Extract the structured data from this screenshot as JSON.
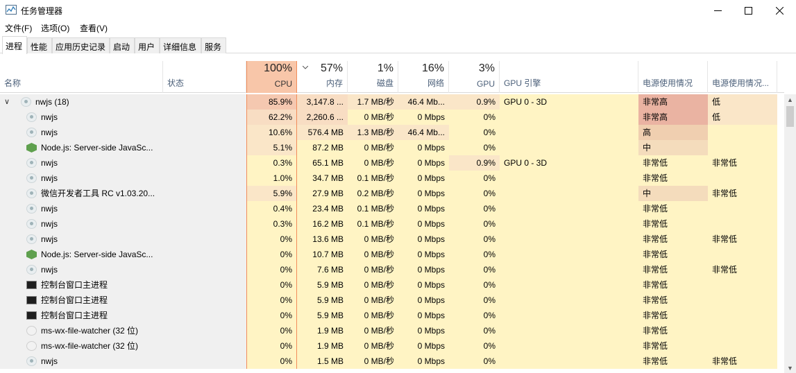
{
  "window": {
    "title": "任务管理器",
    "minimize_glyph": "—",
    "maximize_glyph": "☐",
    "close_glyph": "✕"
  },
  "menu": [
    "文件(F)",
    "选项(O)",
    "查看(V)"
  ],
  "tabs": [
    "进程",
    "性能",
    "应用历史记录",
    "启动",
    "用户",
    "详细信息",
    "服务"
  ],
  "active_tab": "进程",
  "header": {
    "name": "名称",
    "status": "状态",
    "cpu_pct": "100%",
    "cpu": "CPU",
    "mem_pct": "57%",
    "mem": "内存",
    "disk_pct": "1%",
    "disk": "磁盘",
    "net_pct": "16%",
    "net": "网络",
    "gpu_pct": "3%",
    "gpu": "GPU",
    "gpu_engine": "GPU 引擎",
    "power": "电源使用情况",
    "power_trend": "电源使用情况..."
  },
  "colors": {
    "cpu_header_bg": "#f8c6a9",
    "cpu_border": "#f28c5a",
    "heat_very_high": "#f5c8b0",
    "heat_high": "#f8ddc3",
    "heat_mid": "#fae6c8",
    "heat_low": "#fff4c4",
    "heat_lowest": "#fff9dd",
    "power_very_high": "#eab3a2",
    "power_high": "#f0cfb0",
    "power_mid": "#f4dcbc",
    "power_low": "#fff4c4",
    "name_col_bg": "#f0f0f0"
  },
  "processes": [
    {
      "icon": "nwjs-icon",
      "expander": "∨",
      "name": "nwjs (18)",
      "cpu": "85.9%",
      "mem": "3,147.8 ...",
      "disk": "1.7 MB/秒",
      "net": "46.4 Mb...",
      "gpu": "0.9%",
      "gpu_engine": "GPU 0 - 3D",
      "power": "非常高",
      "power_trend": "低",
      "heat": {
        "cpu": "very_high",
        "mem": "high",
        "disk": "mid",
        "net": "mid",
        "gpu": "mid",
        "power": "very_high",
        "trend": "mid"
      }
    },
    {
      "icon": "nwjs-icon",
      "name": "nwjs",
      "cpu": "62.2%",
      "mem": "2,260.6 ...",
      "disk": "0 MB/秒",
      "net": "0 Mbps",
      "gpu": "0%",
      "gpu_engine": "",
      "power": "非常高",
      "power_trend": "低",
      "heat": {
        "cpu": "high",
        "mem": "high",
        "disk": "low",
        "net": "low",
        "gpu": "low",
        "power": "very_high",
        "trend": "mid"
      }
    },
    {
      "icon": "nwjs-icon",
      "name": "nwjs",
      "cpu": "10.6%",
      "mem": "576.4 MB",
      "disk": "1.3 MB/秒",
      "net": "46.4 Mb...",
      "gpu": "0%",
      "gpu_engine": "",
      "power": "高",
      "power_trend": "",
      "heat": {
        "cpu": "mid",
        "mem": "mid",
        "disk": "mid",
        "net": "mid",
        "gpu": "low",
        "power": "high",
        "trend": "low"
      }
    },
    {
      "icon": "nodejs-icon",
      "name": "Node.js: Server-side JavaSc...",
      "cpu": "5.1%",
      "mem": "87.2 MB",
      "disk": "0 MB/秒",
      "net": "0 Mbps",
      "gpu": "0%",
      "gpu_engine": "",
      "power": "中",
      "power_trend": "",
      "heat": {
        "cpu": "mid",
        "mem": "low",
        "disk": "low",
        "net": "low",
        "gpu": "low",
        "power": "mid",
        "trend": "low"
      }
    },
    {
      "icon": "nwjs-icon",
      "name": "nwjs",
      "cpu": "0.3%",
      "mem": "65.1 MB",
      "disk": "0 MB/秒",
      "net": "0 Mbps",
      "gpu": "0.9%",
      "gpu_engine": "GPU 0 - 3D",
      "power": "非常低",
      "power_trend": "非常低",
      "heat": {
        "cpu": "low",
        "mem": "low",
        "disk": "low",
        "net": "low",
        "gpu": "mid",
        "power": "low",
        "trend": "low"
      }
    },
    {
      "icon": "nwjs-icon",
      "name": "nwjs",
      "cpu": "1.0%",
      "mem": "34.7 MB",
      "disk": "0.1 MB/秒",
      "net": "0 Mbps",
      "gpu": "0%",
      "gpu_engine": "",
      "power": "非常低",
      "power_trend": "",
      "heat": {
        "cpu": "low",
        "mem": "low",
        "disk": "low",
        "net": "low",
        "gpu": "low",
        "power": "low",
        "trend": "low"
      }
    },
    {
      "icon": "nwjs-icon",
      "name": "微信开发者工具 RC v1.03.20...",
      "cpu": "5.9%",
      "mem": "27.9 MB",
      "disk": "0.2 MB/秒",
      "net": "0 Mbps",
      "gpu": "0%",
      "gpu_engine": "",
      "power": "中",
      "power_trend": "非常低",
      "heat": {
        "cpu": "mid",
        "mem": "low",
        "disk": "low",
        "net": "low",
        "gpu": "low",
        "power": "mid",
        "trend": "low"
      }
    },
    {
      "icon": "nwjs-icon",
      "name": "nwjs",
      "cpu": "0.4%",
      "mem": "23.4 MB",
      "disk": "0.1 MB/秒",
      "net": "0 Mbps",
      "gpu": "0%",
      "gpu_engine": "",
      "power": "非常低",
      "power_trend": "",
      "heat": {
        "cpu": "low",
        "mem": "low",
        "disk": "low",
        "net": "low",
        "gpu": "low",
        "power": "low",
        "trend": "low"
      }
    },
    {
      "icon": "nwjs-icon",
      "name": "nwjs",
      "cpu": "0.3%",
      "mem": "16.2 MB",
      "disk": "0.1 MB/秒",
      "net": "0 Mbps",
      "gpu": "0%",
      "gpu_engine": "",
      "power": "非常低",
      "power_trend": "",
      "heat": {
        "cpu": "low",
        "mem": "low",
        "disk": "low",
        "net": "low",
        "gpu": "low",
        "power": "low",
        "trend": "low"
      }
    },
    {
      "icon": "nwjs-icon",
      "name": "nwjs",
      "cpu": "0%",
      "mem": "13.6 MB",
      "disk": "0 MB/秒",
      "net": "0 Mbps",
      "gpu": "0%",
      "gpu_engine": "",
      "power": "非常低",
      "power_trend": "非常低",
      "heat": {
        "cpu": "low",
        "mem": "low",
        "disk": "low",
        "net": "low",
        "gpu": "low",
        "power": "low",
        "trend": "low"
      }
    },
    {
      "icon": "nodejs-icon",
      "name": "Node.js: Server-side JavaSc...",
      "cpu": "0%",
      "mem": "10.7 MB",
      "disk": "0 MB/秒",
      "net": "0 Mbps",
      "gpu": "0%",
      "gpu_engine": "",
      "power": "非常低",
      "power_trend": "",
      "heat": {
        "cpu": "low",
        "mem": "low",
        "disk": "low",
        "net": "low",
        "gpu": "low",
        "power": "low",
        "trend": "low"
      }
    },
    {
      "icon": "nwjs-icon",
      "name": "nwjs",
      "cpu": "0%",
      "mem": "7.6 MB",
      "disk": "0 MB/秒",
      "net": "0 Mbps",
      "gpu": "0%",
      "gpu_engine": "",
      "power": "非常低",
      "power_trend": "非常低",
      "heat": {
        "cpu": "low",
        "mem": "low",
        "disk": "low",
        "net": "low",
        "gpu": "low",
        "power": "low",
        "trend": "low"
      }
    },
    {
      "icon": "console-icon",
      "name": "控制台窗口主进程",
      "cpu": "0%",
      "mem": "5.9 MB",
      "disk": "0 MB/秒",
      "net": "0 Mbps",
      "gpu": "0%",
      "gpu_engine": "",
      "power": "非常低",
      "power_trend": "",
      "heat": {
        "cpu": "low",
        "mem": "low",
        "disk": "low",
        "net": "low",
        "gpu": "low",
        "power": "low",
        "trend": "low"
      }
    },
    {
      "icon": "console-icon",
      "name": "控制台窗口主进程",
      "cpu": "0%",
      "mem": "5.9 MB",
      "disk": "0 MB/秒",
      "net": "0 Mbps",
      "gpu": "0%",
      "gpu_engine": "",
      "power": "非常低",
      "power_trend": "",
      "heat": {
        "cpu": "low",
        "mem": "low",
        "disk": "low",
        "net": "low",
        "gpu": "low",
        "power": "low",
        "trend": "low"
      }
    },
    {
      "icon": "console-icon",
      "name": "控制台窗口主进程",
      "cpu": "0%",
      "mem": "5.9 MB",
      "disk": "0 MB/秒",
      "net": "0 Mbps",
      "gpu": "0%",
      "gpu_engine": "",
      "power": "非常低",
      "power_trend": "",
      "heat": {
        "cpu": "low",
        "mem": "low",
        "disk": "low",
        "net": "low",
        "gpu": "low",
        "power": "low",
        "trend": "low"
      }
    },
    {
      "icon": "watcher-icon",
      "name": "ms-wx-file-watcher (32 位)",
      "cpu": "0%",
      "mem": "1.9 MB",
      "disk": "0 MB/秒",
      "net": "0 Mbps",
      "gpu": "0%",
      "gpu_engine": "",
      "power": "非常低",
      "power_trend": "",
      "heat": {
        "cpu": "low",
        "mem": "low",
        "disk": "low",
        "net": "low",
        "gpu": "low",
        "power": "low",
        "trend": "low"
      }
    },
    {
      "icon": "watcher-icon",
      "name": "ms-wx-file-watcher (32 位)",
      "cpu": "0%",
      "mem": "1.9 MB",
      "disk": "0 MB/秒",
      "net": "0 Mbps",
      "gpu": "0%",
      "gpu_engine": "",
      "power": "非常低",
      "power_trend": "",
      "heat": {
        "cpu": "low",
        "mem": "low",
        "disk": "low",
        "net": "low",
        "gpu": "low",
        "power": "low",
        "trend": "low"
      }
    },
    {
      "icon": "nwjs-icon",
      "name": "nwjs",
      "cpu": "0%",
      "mem": "1.5 MB",
      "disk": "0 MB/秒",
      "net": "0 Mbps",
      "gpu": "0%",
      "gpu_engine": "",
      "power": "非常低",
      "power_trend": "非常低",
      "heat": {
        "cpu": "low",
        "mem": "low",
        "disk": "low",
        "net": "low",
        "gpu": "low",
        "power": "low",
        "trend": "low"
      }
    }
  ]
}
